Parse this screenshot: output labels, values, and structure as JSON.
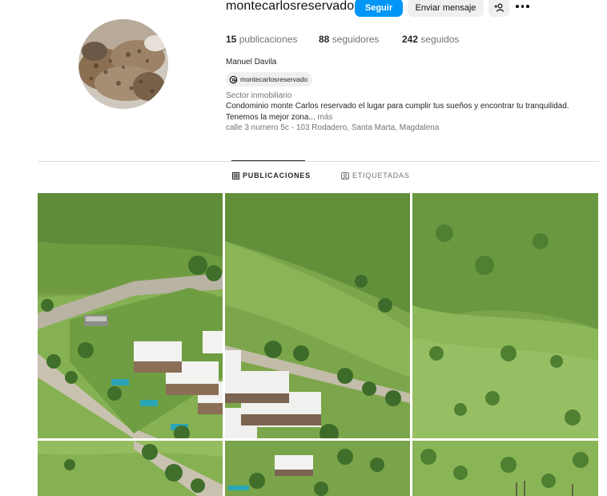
{
  "profile": {
    "username": "montecarlosreservado",
    "follow_label": "Seguir",
    "message_label": "Enviar mensaje",
    "add_user_icon": "add-user-icon",
    "more_icon": "more-options-icon",
    "stats": {
      "posts_count": "15",
      "posts_label": "publicaciones",
      "followers_count": "88",
      "followers_label": "seguidores",
      "following_count": "242",
      "following_label": "seguidos"
    },
    "full_name": "Manuel Davila",
    "threads_handle": "montecarlosreservado",
    "category": "Sector inmobiliario",
    "bio_line1": "Condominio monte Carlos reservado el lugar para cumplir tus sueños y encontrar tu tranquilidad.",
    "bio_line2": "Tenemos la mejor zona...",
    "more_label": "más",
    "address": "calle 3 numero 5c - 103 Rodadero, Santa Marta, Magdalena"
  },
  "tabs": [
    {
      "label": "PUBLICACIONES",
      "icon": "grid-icon",
      "active": true
    },
    {
      "label": "ETIQUETADAS",
      "icon": "tagged-icon",
      "active": false
    }
  ],
  "posts": [
    {
      "scene": "hillside-condos-aerial"
    },
    {
      "scene": "hillside-condos-road"
    },
    {
      "scene": "green-hillside"
    },
    {
      "scene": "hillside-road-green"
    },
    {
      "scene": "hillside-house"
    },
    {
      "scene": "green-slope-trees"
    }
  ],
  "colors": {
    "primary_button": "#0095f6",
    "secondary_button": "#efefef",
    "muted_text": "#737373",
    "divider": "#dbdbdb"
  }
}
